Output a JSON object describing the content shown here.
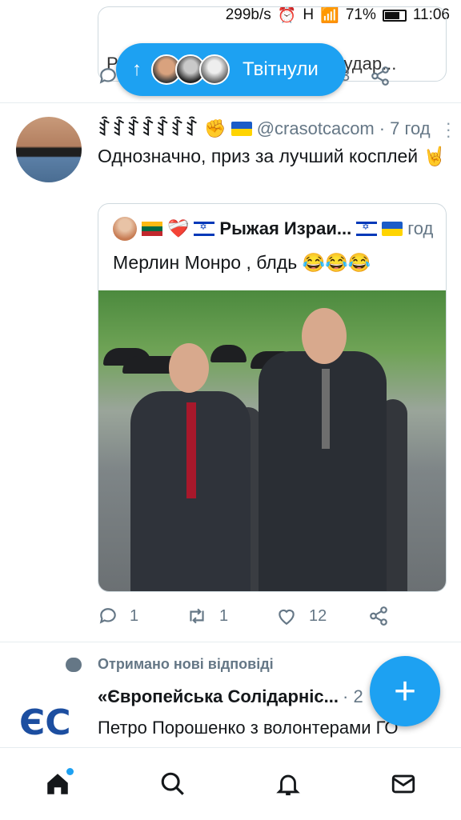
{
  "status_bar": {
    "net_speed": "299b/s",
    "alarm_icon": "⏰",
    "network": "H",
    "signal": "📶",
    "battery_percent": "71%",
    "time": "11:06"
  },
  "previous_tweet": {
    "quoted_text_fragment": "Росии списки для нашего государ...",
    "share_count": "3"
  },
  "new_tweets_pill": {
    "label": "Твітнули"
  },
  "tweet": {
    "author_name": "ꆎꆎꆎꆎꆎꆎꆎ",
    "fist_emoji": "✊",
    "handle": "@crasotcacom",
    "separator": "·",
    "date": "7 год",
    "text": "Однозначно, приз за лучший косплей 🤘",
    "quoted": {
      "author_name": "Рыжая Израи...",
      "heart_emoji": "❤️‍🩹",
      "date": "год",
      "text": "Мерлин Монро , блдь 😂😂😂"
    },
    "reply_count": "1",
    "retweet_count": "1",
    "like_count": "12"
  },
  "notification": {
    "title": "Отримано нові відповіді",
    "author_name": "«Європейська Солідарніс...",
    "date": "· 2",
    "logo_text": "ЄС",
    "text": "Петро Порошенко з волонтерами ГО «Справа Громад» підготували для"
  },
  "fab": {
    "label": "+"
  },
  "bottom_nav": {
    "items": [
      "home",
      "search",
      "notifications",
      "messages"
    ]
  },
  "colors": {
    "accent": "#1da1f2",
    "secondary_text": "#657786",
    "border": "#cfd9de"
  }
}
